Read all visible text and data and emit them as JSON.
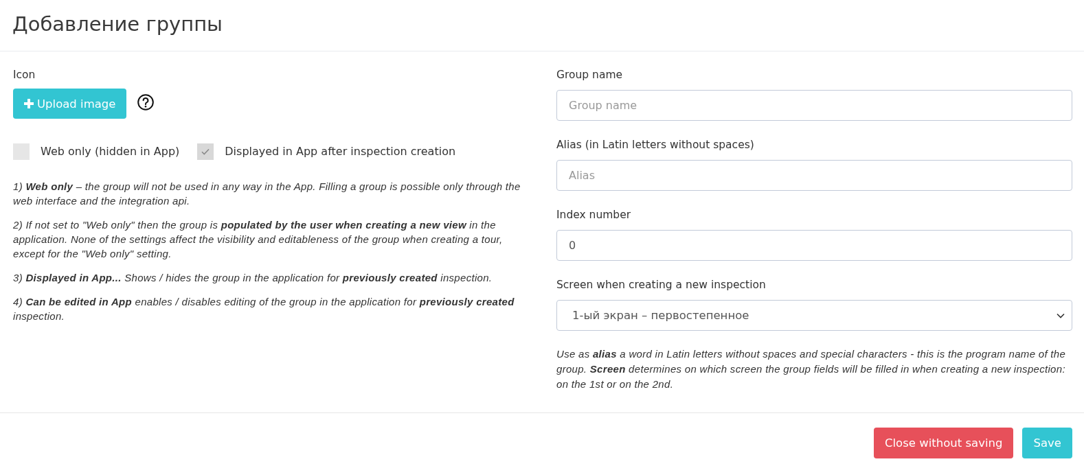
{
  "header": {
    "title": "Добавление группы"
  },
  "icon_section": {
    "label": "Icon",
    "upload_button": {
      "label": "Upload image"
    }
  },
  "checkboxes": [
    {
      "label": "Web only (hidden in App)",
      "checked": false
    },
    {
      "label": "Displayed in App after inspection creation",
      "checked": true
    }
  ],
  "notes": [
    "1) **Web only** – the group will not be used in any way in the App. Filling a group is possible only through the web interface and the integration api.",
    "2) If not set to \"Web only\" then the group is **populated by the user when creating a new view** in the application. None of the settings affect the visibility and editableness of the group when creating a tour, except for the \"Web only\" setting.",
    "3) **Displayed in App...** Shows / hides the group in the application for **previously created** inspection.",
    "4) **Can be edited in App** enables / disables editing of the group in the application for **previously created** inspection."
  ],
  "fields": [
    {
      "kind": "input",
      "label": "Group name",
      "placeholder": "Group name"
    },
    {
      "kind": "input",
      "label": "Alias (in Latin letters without spaces)",
      "placeholder": "Alias"
    },
    {
      "kind": "input",
      "label": "Index number",
      "value": "0"
    },
    {
      "kind": "select",
      "label": "Screen when creating a new inspection",
      "value": "1-ый экран – первостепенное"
    }
  ],
  "fields_note": "Use as **alias** a word in Latin letters without spaces and special characters - this is the program name of the group. **Screen** determines on which screen the group fields will be filled in when creating a new inspection: on the 1st or on the 2nd.",
  "footer": {
    "buttons": [
      {
        "kind": "danger",
        "label": "Close without saving"
      },
      {
        "kind": "primary",
        "label": "Save"
      }
    ]
  }
}
